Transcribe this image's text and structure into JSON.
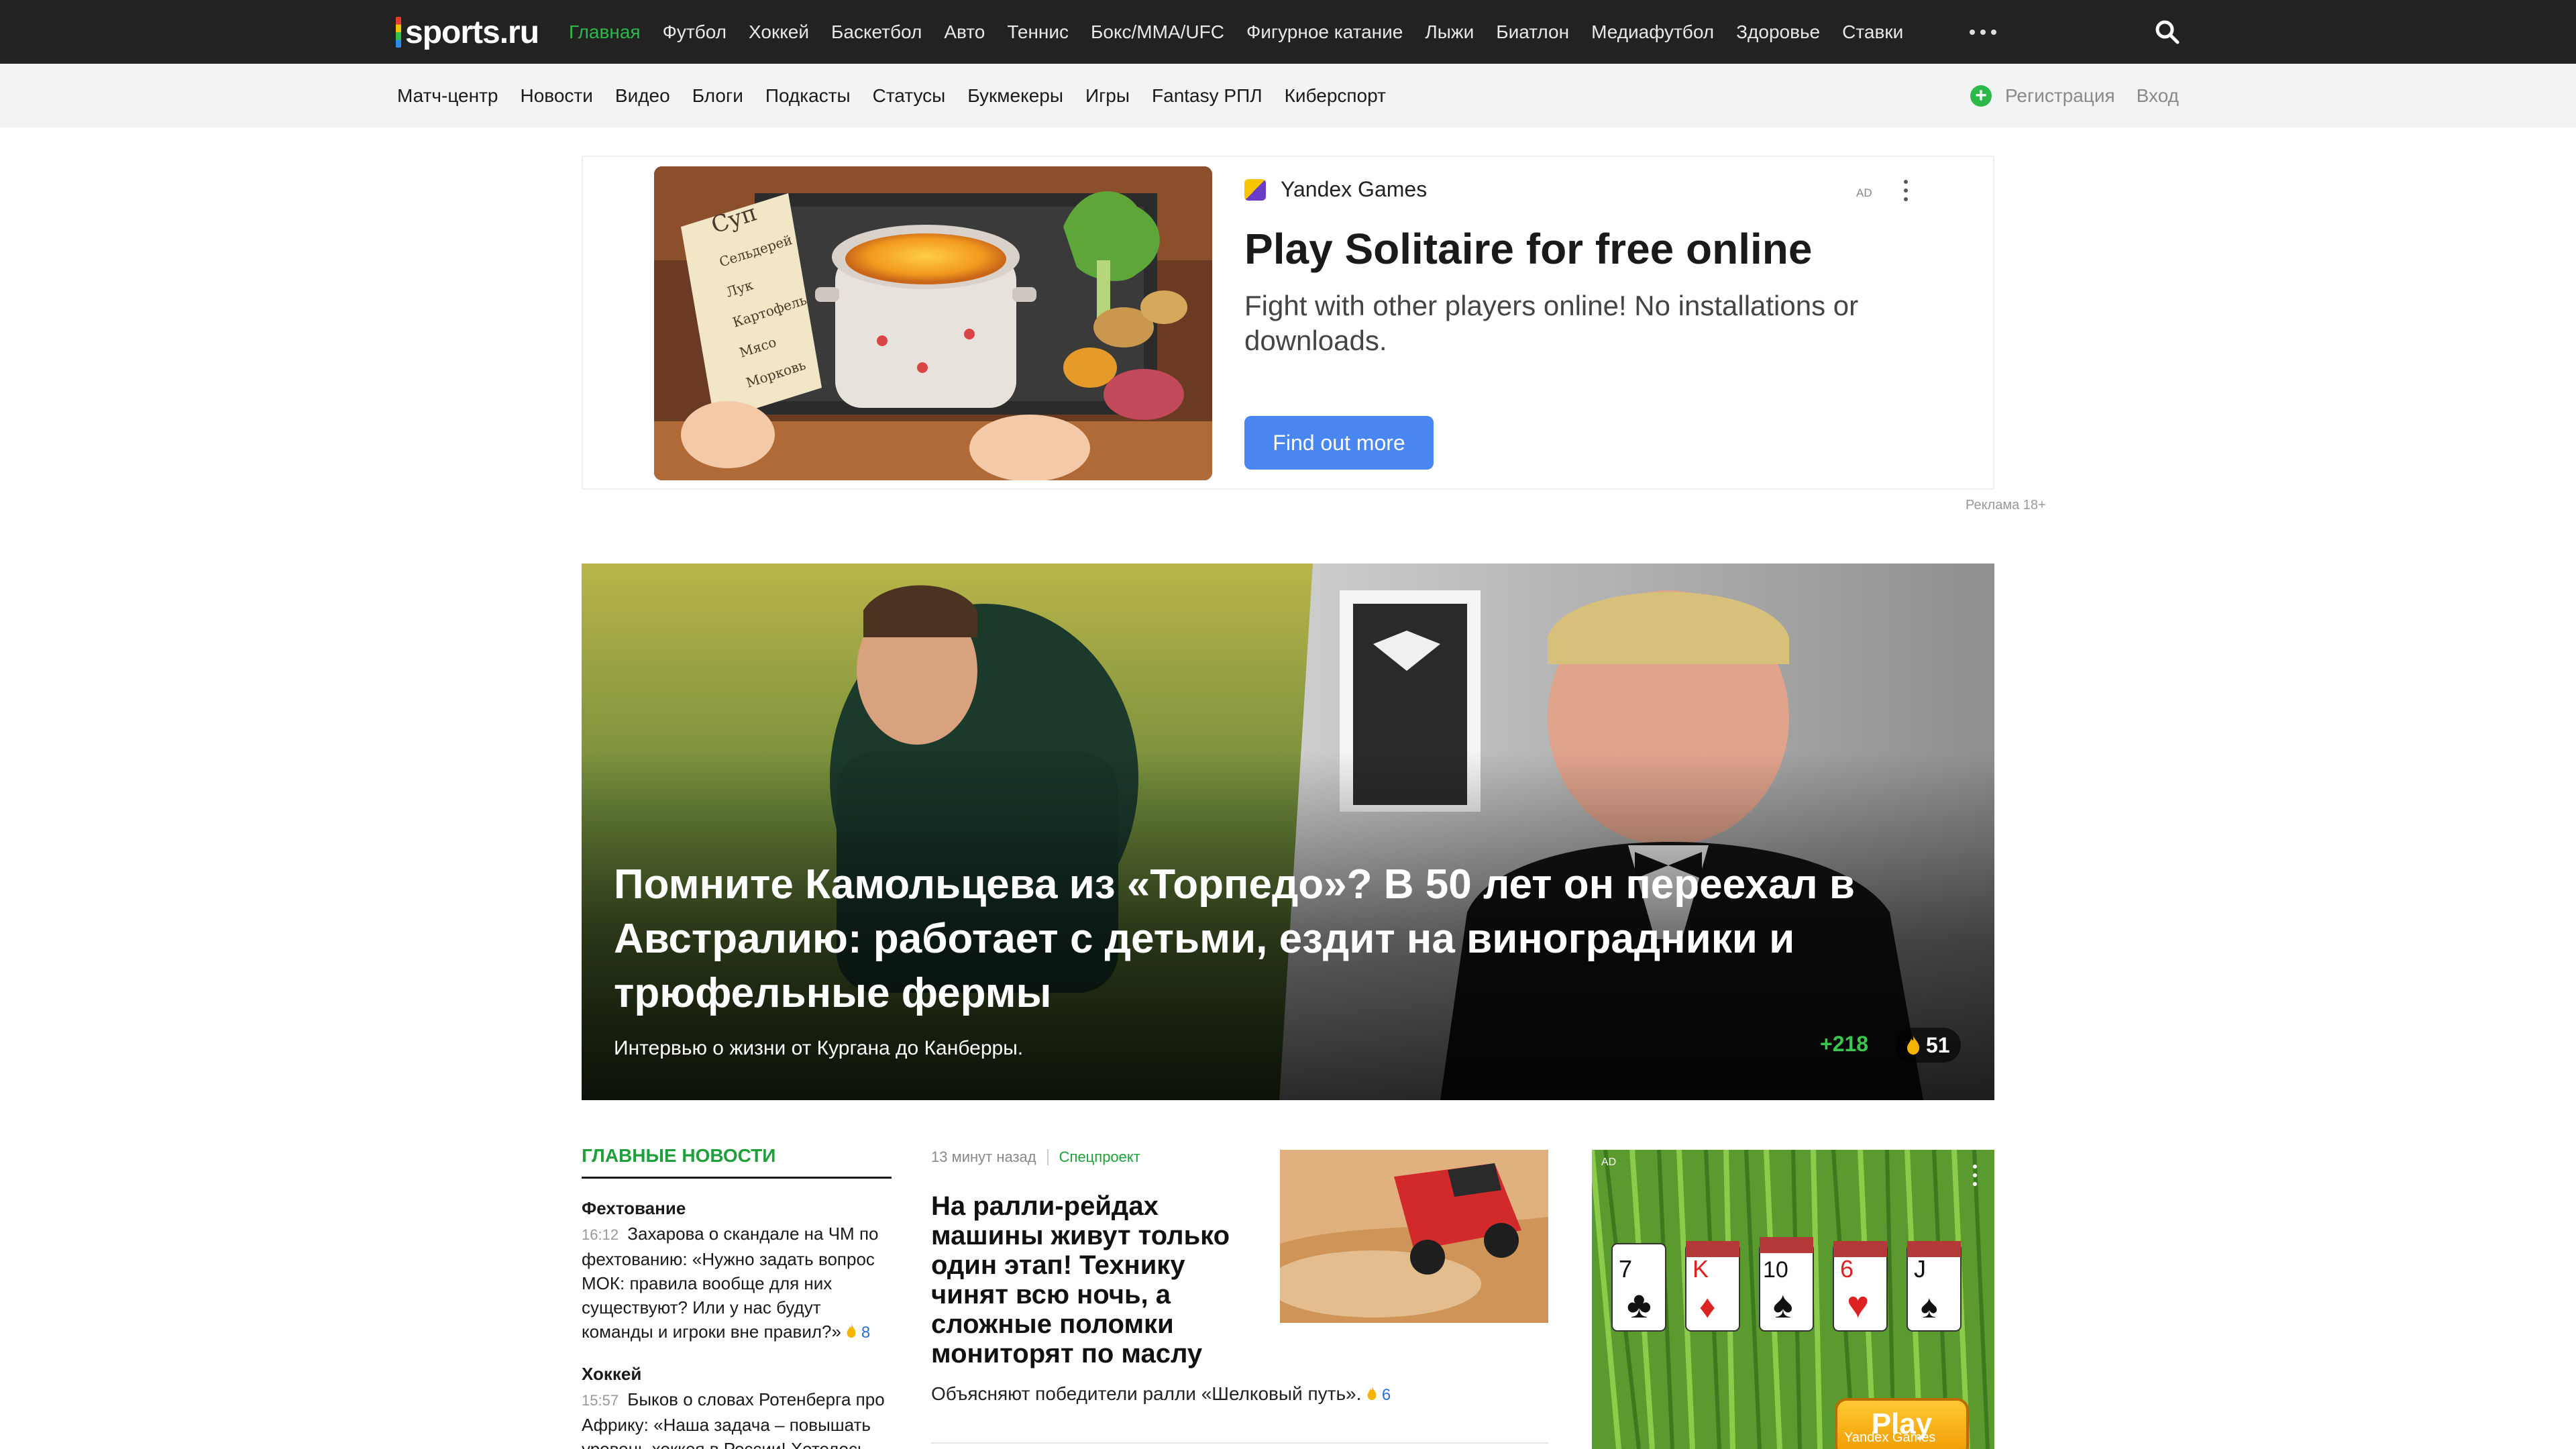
{
  "header": {
    "logo": "sports.ru",
    "nav": [
      "Главная",
      "Футбол",
      "Хоккей",
      "Баскетбол",
      "Авто",
      "Теннис",
      "Бокс/ММА/UFC",
      "Фигурное катание",
      "Лыжи",
      "Биатлон",
      "Медиафутбол",
      "Здоровье",
      "Ставки"
    ],
    "active_index": 0
  },
  "subheader": {
    "nav": [
      "Матч-центр",
      "Новости",
      "Видео",
      "Блоги",
      "Подкасты",
      "Статусы",
      "Букмекеры",
      "Игры",
      "Fantasy РПЛ",
      "Киберспорт"
    ],
    "register": "Регистрация",
    "login": "Вход"
  },
  "ad_banner": {
    "brand": "Yandex Games",
    "mark": "AD",
    "title": "Play Solitaire for free online",
    "description": "Fight with other players online! No installations or downloads.",
    "cta": "Find out more",
    "note": "Реклама 18+",
    "image_words": [
      "Суп",
      "Сельдерей",
      "Лук",
      "Картофель",
      "Мясо",
      "Морковь"
    ]
  },
  "hero": {
    "title": "Помните Камольцева из «Торпедо»? В 50 лет он переехал в Австралию: работает с детьми, ездит на виноградники и трюфельные фермы",
    "subtitle": "Интервью о жизни от Кургана до Канберры.",
    "rating": "+218",
    "fire": "51"
  },
  "main_news": {
    "heading": "ГЛАВНЫЕ НОВОСТИ",
    "items": [
      {
        "category": "Фехтование",
        "time": "16:12",
        "text": "Захарова о скандале на ЧМ по фехтованию: «Нужно задать вопрос МОК: правила вообще для них существуют? Или у нас будут команды и игроки вне правил?»",
        "fire": "8"
      },
      {
        "category": "Хоккей",
        "time": "15:57",
        "text": "Быков о словах Ротенберга про Африку: «Наша задача – повышать уровень хоккея в России! Хотелось",
        "fire": ""
      }
    ]
  },
  "feature_article": {
    "time": "13 минут назад",
    "tag": "Спецпроект",
    "title": "На ралли-рейдах машины живут только один этап! Технику чинят всю ночь, а сложные поломки мониторят по маслу",
    "subtitle": "Объясняют победители ралли «Шелковый путь».",
    "fire": "6"
  },
  "side_ad": {
    "mark": "AD",
    "cards": [
      "7",
      "K",
      "10",
      "6",
      "J"
    ],
    "play": "Play",
    "brand": "Yandex Games"
  },
  "colors": {
    "accent": "#2db84b",
    "topbar": "#222222",
    "subbar": "#f3f3f3",
    "cta": "#4a86f0"
  }
}
